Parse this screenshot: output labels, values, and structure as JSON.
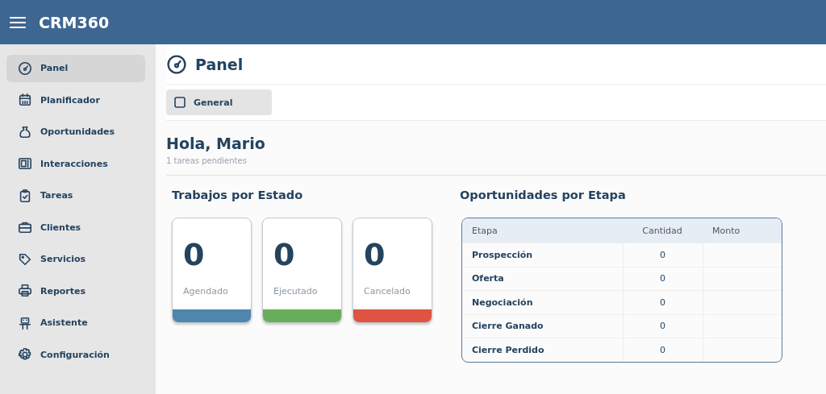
{
  "app_bar": {
    "title": "CRM360"
  },
  "sidebar": {
    "items": [
      {
        "label": "Panel",
        "selected": true
      },
      {
        "label": "Planificador",
        "selected": false
      },
      {
        "label": "Oportunidades",
        "selected": false
      },
      {
        "label": "Interacciones",
        "selected": false
      },
      {
        "label": "Tareas",
        "selected": false
      },
      {
        "label": "Clientes",
        "selected": false
      },
      {
        "label": "Servicios",
        "selected": false
      },
      {
        "label": "Reportes",
        "selected": false
      },
      {
        "label": "Asistente",
        "selected": false
      },
      {
        "label": "Configuración",
        "selected": false
      }
    ]
  },
  "page": {
    "title": "Panel"
  },
  "tabs": [
    {
      "label": "General",
      "selected": true
    }
  ],
  "greeting": {
    "title": "Hola, Mario",
    "subtitle": "1 tareas pendientes"
  },
  "jobs": {
    "title": "Trabajos por Estado",
    "cards": [
      {
        "value": "0",
        "label": "Agendado",
        "color": "#4f86ad"
      },
      {
        "value": "0",
        "label": "Ejecutado",
        "color": "#67ae5a"
      },
      {
        "value": "0",
        "label": "Cancelado",
        "color": "#e05242"
      }
    ]
  },
  "opportunities": {
    "title": "Oportunidades por Etapa",
    "table": {
      "columns": [
        "Etapa",
        "Cantidad",
        "Monto"
      ],
      "rows": [
        [
          "Prospección",
          "0"
        ],
        [
          "Oferta",
          "0"
        ],
        [
          "Negociación",
          "0"
        ],
        [
          "Cierre Ganado",
          "0"
        ],
        [
          "Cierre Perdido",
          "0"
        ]
      ]
    }
  }
}
